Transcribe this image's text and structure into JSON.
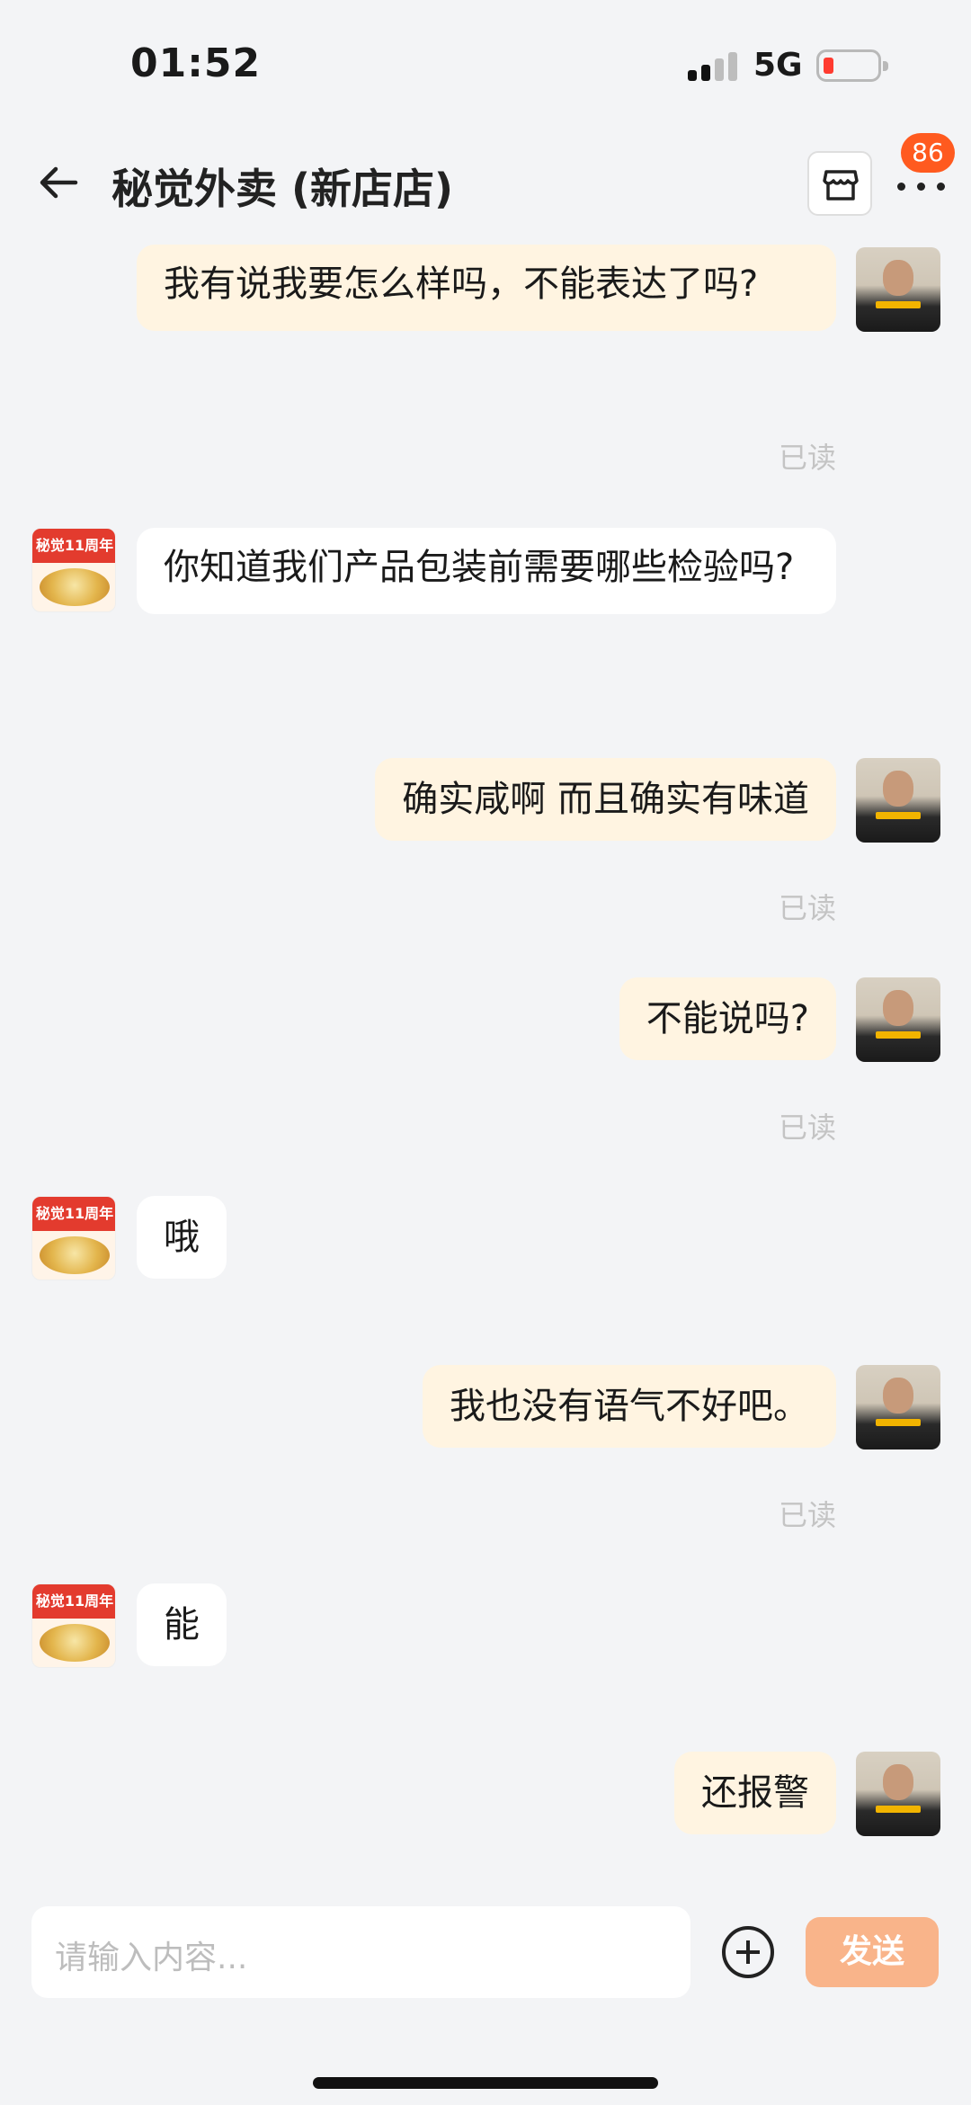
{
  "status_bar": {
    "time": "01:52",
    "network": "5G"
  },
  "header": {
    "title": "秘觉外卖 (新店店)",
    "badge_count": "86"
  },
  "messages": [
    {
      "sender": "me",
      "text": "我有说我要怎么样吗，不能表达了吗?",
      "status": "已读"
    },
    {
      "sender": "shop",
      "text": "你知道我们产品包装前需要哪些检验吗?"
    },
    {
      "sender": "me",
      "text": "确实咸啊 而且确实有味道",
      "status": "已读"
    },
    {
      "sender": "me",
      "text": "不能说吗?",
      "status": "已读"
    },
    {
      "sender": "shop",
      "text": "哦"
    },
    {
      "sender": "me",
      "text": "我也没有语气不好吧。",
      "status": "已读"
    },
    {
      "sender": "shop",
      "text": "能"
    },
    {
      "sender": "me",
      "text": "还报警"
    }
  ],
  "shop_avatar": {
    "banner_text": "秘觉11周年"
  },
  "composer": {
    "placeholder": "请输入内容...",
    "send_label": "发送"
  },
  "colors": {
    "accent": "#ff5a1f",
    "send_button": "#f9b48a",
    "my_bubble": "#fff4e1"
  },
  "icons": [
    "back-arrow-icon",
    "store-icon",
    "more-icon",
    "plus-circle-icon"
  ]
}
